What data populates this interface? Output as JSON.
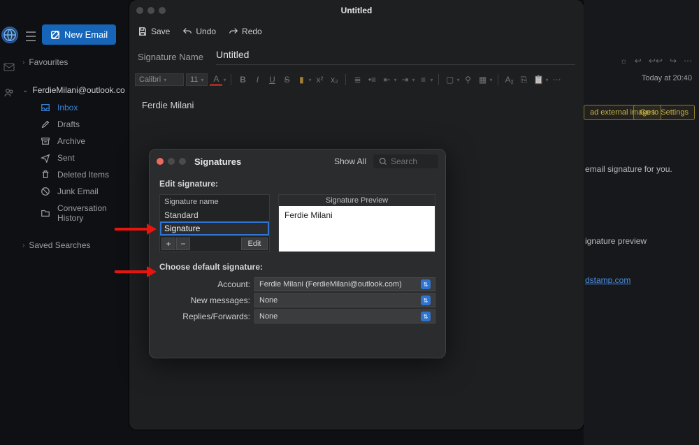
{
  "app": {
    "new_email_label": "New Email"
  },
  "sidebar": {
    "favourites_label": "Favourites",
    "account_label": "FerdieMilani@outlook.co",
    "saved_searches_label": "Saved Searches",
    "folders": [
      {
        "label": "Inbox",
        "icon": "inbox",
        "active": true
      },
      {
        "label": "Drafts",
        "icon": "pencil",
        "active": false
      },
      {
        "label": "Archive",
        "icon": "archive",
        "active": false
      },
      {
        "label": "Sent",
        "icon": "sent",
        "active": false
      },
      {
        "label": "Deleted Items",
        "icon": "trash",
        "active": false
      },
      {
        "label": "Junk Email",
        "icon": "junk",
        "active": false
      },
      {
        "label": "Conversation History",
        "icon": "folder",
        "active": false
      }
    ]
  },
  "editor": {
    "window_title": "Untitled",
    "save_label": "Save",
    "undo_label": "Undo",
    "redo_label": "Redo",
    "signature_name_label": "Signature Name",
    "signature_name_value": "Untitled",
    "font_name": "Calibri",
    "font_size": "11",
    "body_text": "Ferdie Milani"
  },
  "signatures_dialog": {
    "title": "Signatures",
    "show_all_label": "Show All",
    "search_placeholder": "Search",
    "edit_signature_label": "Edit signature:",
    "list_header": "Signature name",
    "items": [
      {
        "name": "Standard",
        "editing": false
      },
      {
        "name": "Signature",
        "editing": true
      }
    ],
    "add_label": "+",
    "remove_label": "−",
    "edit_btn_label": "Edit",
    "preview_header": "Signature Preview",
    "preview_body": "Ferdie Milani",
    "defaults_header": "Choose default signature:",
    "account_label": "Account:",
    "account_value": "Ferdie Milani (FerdieMilani@outlook.com)",
    "new_messages_label": "New messages:",
    "new_messages_value": "None",
    "replies_label": "Replies/Forwards:",
    "replies_value": "None"
  },
  "background_pane": {
    "timestamp": "Today at 20:40",
    "chip1_label": "ad external images",
    "chip2_label": "Go to Settings",
    "line1": "email signature for you.",
    "line2": "ignature preview",
    "link_text": "dstamp.com"
  }
}
